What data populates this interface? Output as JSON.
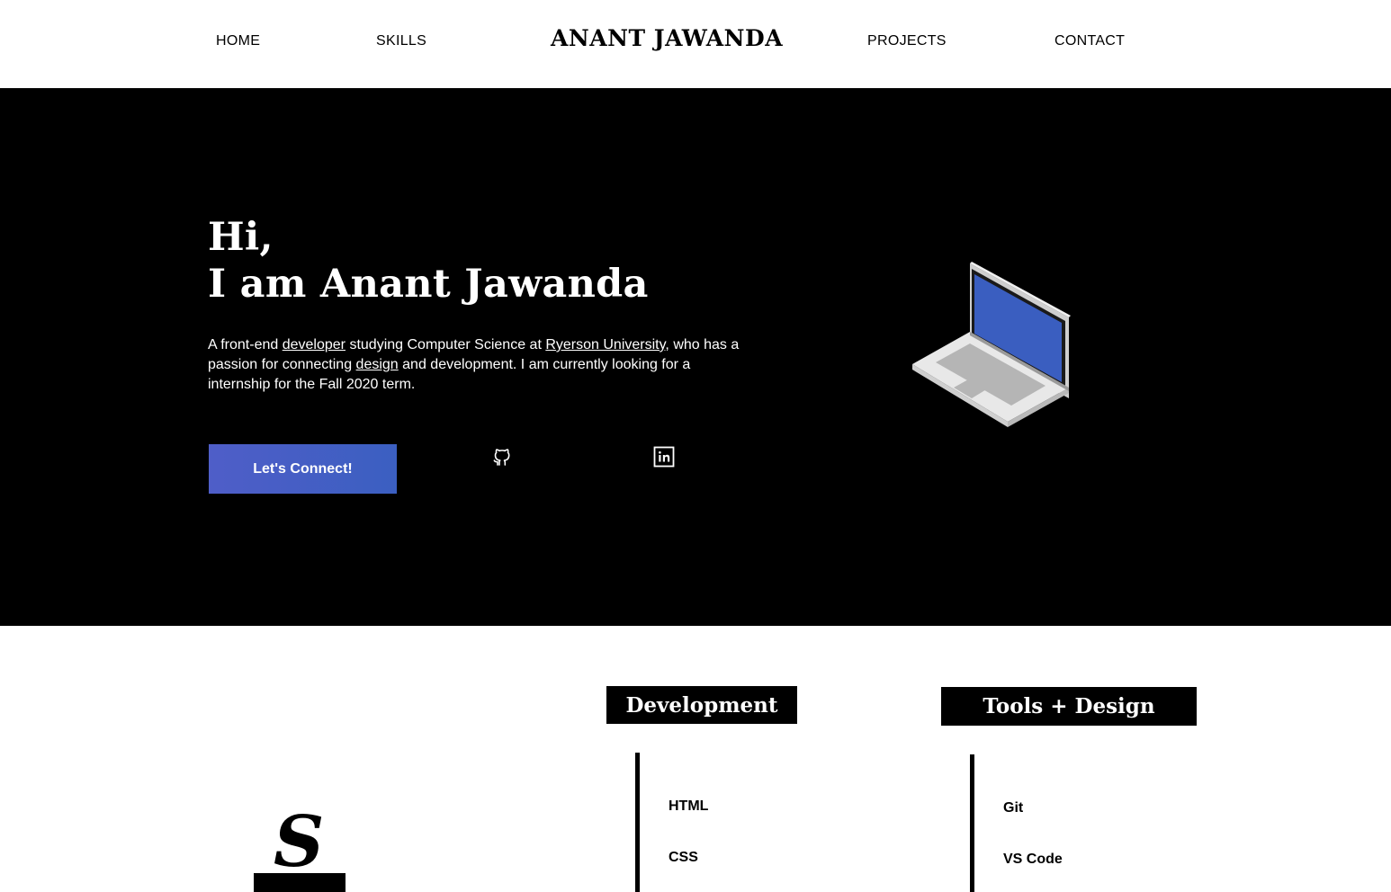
{
  "header": {
    "nav_home": "HOME",
    "nav_skills": "SKILLS",
    "brand": "ANANT JAWANDA",
    "nav_projects": "PROJECTS",
    "nav_contact": "CONTACT"
  },
  "hero": {
    "greeting_line1": "Hi,",
    "greeting_line2": "I am Anant Jawanda",
    "desc_part1": "A front-end ",
    "desc_link_developer": "developer",
    "desc_part2": " studying Computer Science at ",
    "desc_link_university": "Ryerson University",
    "desc_part3": ", who has a passion for connecting ",
    "desc_link_design": "design",
    "desc_part4": " and development. I am currently looking for a internship for the Fall 2020 term.",
    "cta_label": "Let's Connect!",
    "icons": [
      "github-icon",
      "linkedin-icon",
      "laptop-icon"
    ],
    "background_color": "#000000",
    "cta_color": "#3b5fc1"
  },
  "skills": {
    "development_heading": "Development",
    "development_items": [
      "HTML",
      "CSS"
    ],
    "tools_heading": "Tools + Design",
    "tools_items": [
      "Git",
      "VS Code"
    ]
  }
}
